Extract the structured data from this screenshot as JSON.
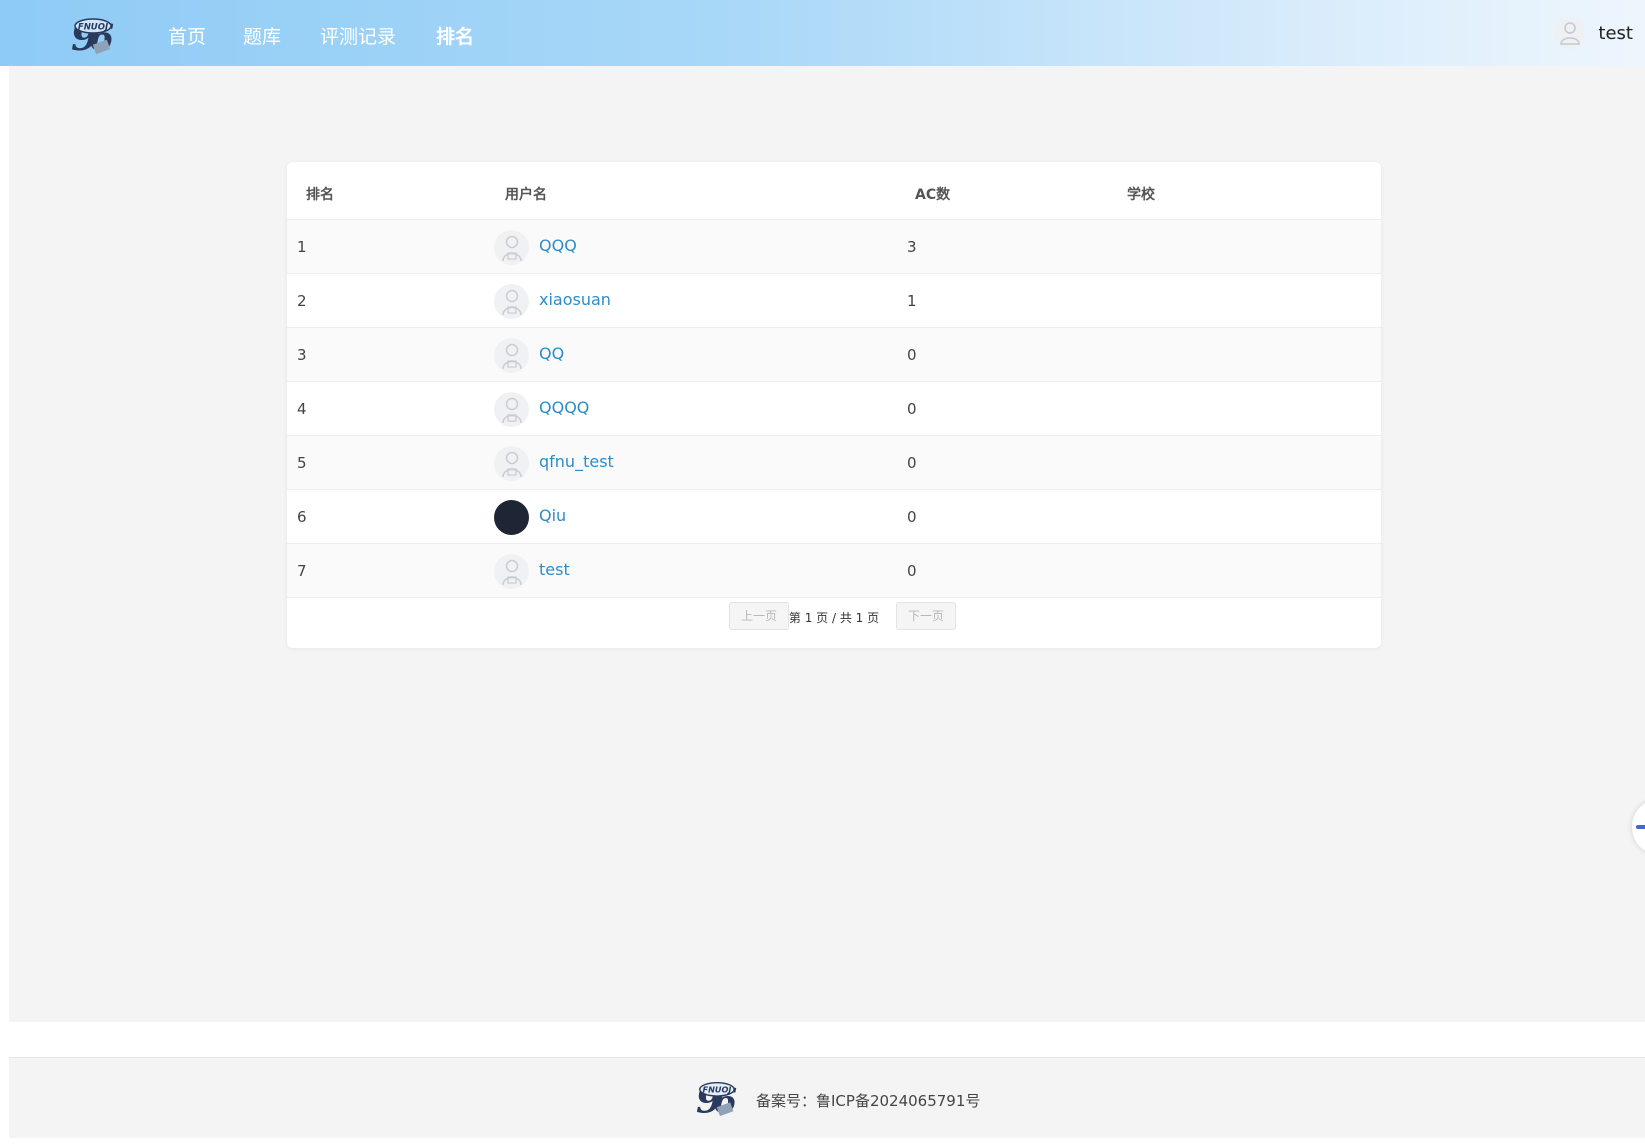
{
  "nav": {
    "logo_text": "FNUOJ",
    "items": [
      {
        "label": "首页"
      },
      {
        "label": "题库"
      },
      {
        "label": "评测记录"
      },
      {
        "label": "排名"
      }
    ],
    "active_index": 3,
    "user": {
      "name": "test"
    }
  },
  "table": {
    "headers": {
      "rank": "排名",
      "username": "用户名",
      "ac": "AC数",
      "school": "学校"
    },
    "rows": [
      {
        "rank": "1",
        "username": "QQQ",
        "ac": "3",
        "school": "",
        "avatar": "default-avatar-icon"
      },
      {
        "rank": "2",
        "username": "xiaosuan",
        "ac": "1",
        "school": "",
        "avatar": "default-avatar-icon"
      },
      {
        "rank": "3",
        "username": "QQ",
        "ac": "0",
        "school": "",
        "avatar": "default-avatar-icon"
      },
      {
        "rank": "4",
        "username": "QQQQ",
        "ac": "0",
        "school": "",
        "avatar": "default-avatar-icon"
      },
      {
        "rank": "5",
        "username": "qfnu_test",
        "ac": "0",
        "school": "",
        "avatar": "default-avatar-icon"
      },
      {
        "rank": "6",
        "username": "Qiu",
        "ac": "0",
        "school": "",
        "avatar": "dark-avatar-image"
      },
      {
        "rank": "7",
        "username": "test",
        "ac": "0",
        "school": "",
        "avatar": "default-avatar-icon"
      }
    ]
  },
  "pagination": {
    "prev_label": "上一页",
    "info": "第 1 页 / 共 1 页",
    "next_label": "下一页"
  },
  "footer": {
    "icp_text": "备案号：鲁ICP备2024065791号"
  },
  "colors": {
    "header_gradient_start": "#8ecbf5",
    "header_gradient_end": "#eef6fd",
    "username_link": "#2d8cc8",
    "page_background": "#f4f4f4",
    "side_tab_accent": "#4766d4"
  }
}
